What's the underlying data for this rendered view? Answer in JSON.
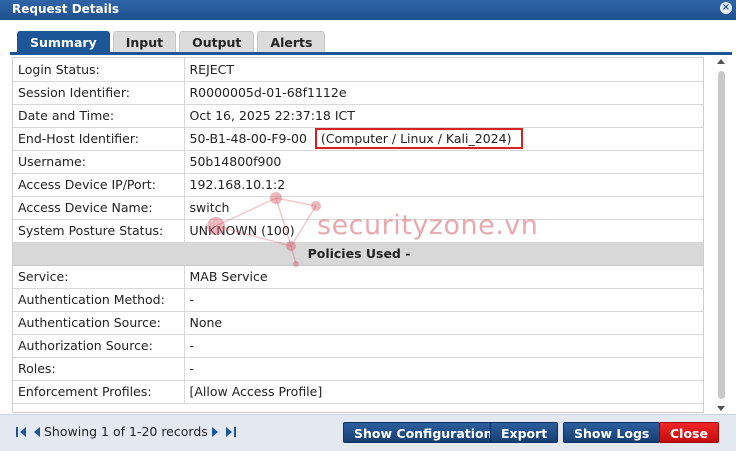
{
  "window": {
    "title": "Request Details",
    "close_glyph": "×"
  },
  "tabs": [
    {
      "label": "Summary",
      "active": true
    },
    {
      "label": "Input",
      "active": false
    },
    {
      "label": "Output",
      "active": false
    },
    {
      "label": "Alerts",
      "active": false
    }
  ],
  "summary": {
    "rows": [
      {
        "key": "Login Status:",
        "value": "REJECT"
      },
      {
        "key": "Session Identifier:",
        "value": "R0000005d-01-68f1112e"
      },
      {
        "key": "Date and Time:",
        "value": "Oct 16, 2025 22:37:18 ICT"
      },
      {
        "key": "End-Host Identifier:",
        "value": "50-B1-48-00-F9-00",
        "extra": "(Computer / Linux / Kali_2024)"
      },
      {
        "key": "Username:",
        "value": "50b14800f900"
      },
      {
        "key": "Access Device IP/Port:",
        "value": "192.168.10.1:2"
      },
      {
        "key": "Access Device Name:",
        "value": "switch"
      },
      {
        "key": "System Posture Status:",
        "value": "UNKNOWN (100)"
      }
    ],
    "policies_header": "Policies Used -",
    "policy_rows": [
      {
        "key": "Service:",
        "value": "MAB Service"
      },
      {
        "key": "Authentication Method:",
        "value": "-"
      },
      {
        "key": "Authentication Source:",
        "value": "None"
      },
      {
        "key": "Authorization Source:",
        "value": "-"
      },
      {
        "key": "Roles:",
        "value": "-"
      },
      {
        "key": "Enforcement Profiles:",
        "value": "[Allow Access Profile]"
      }
    ]
  },
  "watermark": {
    "text": "securityzone.vn"
  },
  "footer": {
    "pager_text": "Showing 1 of 1-20 records",
    "buttons": {
      "show_configuration": "Show Configuration",
      "export": "Export",
      "show_logs": "Show Logs",
      "close": "Close"
    }
  },
  "colors": {
    "accent": "#1d5696",
    "reject": "#c00000",
    "close_button": "#e01414",
    "highlight_box": "#d92020"
  }
}
